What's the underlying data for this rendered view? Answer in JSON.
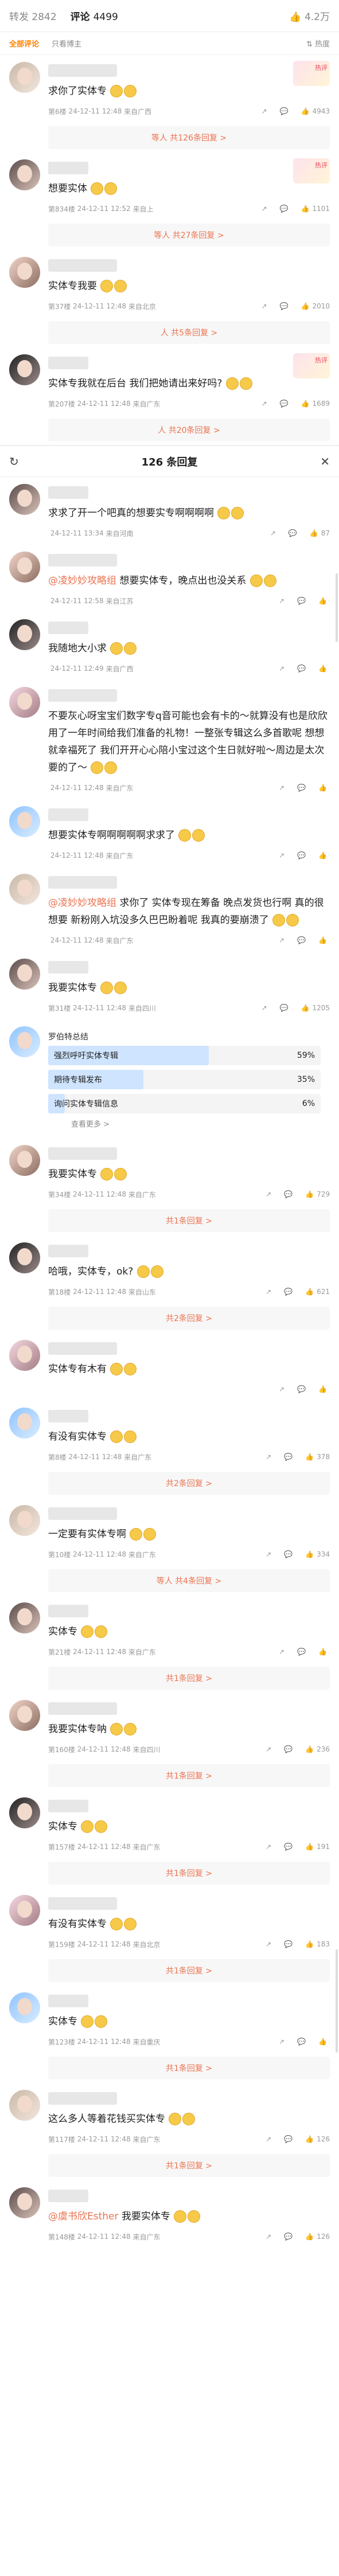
{
  "header": {
    "reposts_label": "转发",
    "reposts_count": "2842",
    "comments_label": "评论",
    "comments_count": "4499",
    "likes_icon": "thumb-up-icon",
    "likes_count": "4.2万"
  },
  "filter": {
    "all_label": "全部评论",
    "blogger_only_label": "只看博主",
    "sort_label": "热度"
  },
  "top_comments": [
    {
      "text": "求你了实体专",
      "floor": "第6楼",
      "time": "24-12-11 12:48",
      "loc": "来自广西",
      "likes": "4943",
      "replies": "等人 共126条回复 >",
      "sticker": "热评"
    },
    {
      "text": "想要实体",
      "floor": "第834楼",
      "time": "24-12-11 12:52",
      "loc": "来自上",
      "likes": "1101",
      "replies": "等人 共27条回复 >",
      "sticker": "热评"
    },
    {
      "text": "实体专我要",
      "floor": "第37楼",
      "time": "24-12-11 12:48",
      "loc": "来自北京",
      "likes": "2010",
      "replies": "人 共5条回复 >",
      "sticker": ""
    },
    {
      "text": "实体专我就在后台 我们把她请出来好吗?",
      "floor": "第207楼",
      "time": "24-12-11 12:48",
      "loc": "来自广东",
      "likes": "1689",
      "replies": "人 共20条回复 >",
      "sticker": "热评"
    }
  ],
  "panel": {
    "title": "126 条回复",
    "refresh_icon": "refresh-icon",
    "close_icon": "close-icon"
  },
  "panel_replies": [
    {
      "text": "求求了开一个吧真的想要实专啊啊啊啊",
      "floor": "",
      "time": "24-12-11 13:34",
      "loc": "来自河南",
      "likes": "87",
      "at": ""
    },
    {
      "text": "想要实体专，晚点出也没关系",
      "floor": "",
      "time": "24-12-11 12:58",
      "loc": "来自江苏",
      "likes": "",
      "at": "@凌妙妙攻略组"
    },
    {
      "text": "我随地大小求",
      "floor": "",
      "time": "24-12-11 12:49",
      "loc": "来自广西",
      "likes": "",
      "at": ""
    },
    {
      "text": "不要灰心呀宝宝们数字专q音可能也会有卡的～就算没有也是欣欣用了一年时间给我们准备的礼物！一整张专辑这么多首歌呢 想想就幸福死了 我们开开心心陪小宝过这个生日就好啦～周边是太次要的了～",
      "floor": "",
      "time": "24-12-11 12:48",
      "loc": "来自广东",
      "likes": "",
      "at": ""
    },
    {
      "text": "想要实体专啊啊啊啊啊求求了",
      "floor": "",
      "time": "24-12-11 12:48",
      "loc": "来自广东",
      "likes": "",
      "at": ""
    },
    {
      "text": "求你了 实体专现在筹备 晚点发货也行啊 真的很想要 新粉刚入坑没多久巴巴盼着呢 我真的要崩溃了",
      "floor": "",
      "time": "24-12-11 12:48",
      "loc": "来自广东",
      "likes": "",
      "at": "@凌妙妙攻略组"
    },
    {
      "text": "我要实体专",
      "floor": "第31楼",
      "time": "24-12-11 12:48",
      "loc": "来自四川",
      "likes": "1205",
      "at": ""
    }
  ],
  "poll": {
    "author": "罗伯特总结",
    "options": [
      {
        "label": "强烈呼吁实体专辑",
        "pct": "59%",
        "fraction": 0.59
      },
      {
        "label": "期待专辑发布",
        "pct": "35%",
        "fraction": 0.35
      },
      {
        "label": "询问实体专辑信息",
        "pct": "6%",
        "fraction": 0.06
      }
    ],
    "more": "查看更多 >"
  },
  "lower_comments": [
    {
      "text": "我要实体专",
      "floor": "第34楼",
      "time": "24-12-11 12:48",
      "loc": "来自广东",
      "likes": "729",
      "replies": "共1条回复 >"
    },
    {
      "text": "哈哦，实体专，ok?",
      "floor": "第18楼",
      "time": "24-12-11 12:48",
      "loc": "来自山东",
      "likes": "621",
      "replies": "共2条回复 >"
    },
    {
      "text": "实体专有木有",
      "floor": "",
      "time": "",
      "loc": "",
      "likes": "",
      "replies": ""
    },
    {
      "text": "有没有实体专",
      "floor": "第8楼",
      "time": "24-12-11 12:48",
      "loc": "来自广东",
      "likes": "378",
      "replies": "共2条回复 >"
    },
    {
      "text": "一定要有实体专啊",
      "floor": "第10楼",
      "time": "24-12-11 12:48",
      "loc": "来自广东",
      "likes": "334",
      "replies": "等人 共4条回复 >"
    },
    {
      "text": "实体专",
      "floor": "第21楼",
      "time": "24-12-11 12:48",
      "loc": "来自广东",
      "likes": "",
      "replies": "共1条回复 >"
    },
    {
      "text": "我要实体专呐",
      "floor": "第160楼",
      "time": "24-12-11 12:48",
      "loc": "来自四川",
      "likes": "236",
      "replies": "共1条回复 >"
    },
    {
      "text": "实体专",
      "floor": "第157楼",
      "time": "24-12-11 12:48",
      "loc": "来自广东",
      "likes": "191",
      "replies": "共1条回复 >"
    },
    {
      "text": "有没有实体专",
      "floor": "第159楼",
      "time": "24-12-11 12:48",
      "loc": "来自北京",
      "likes": "183",
      "replies": "共1条回复 >"
    },
    {
      "text": "实体专",
      "floor": "第123楼",
      "time": "24-12-11 12:48",
      "loc": "来自重庆",
      "likes": "",
      "replies": "共1条回复 >"
    },
    {
      "text": "这么多人等着花钱买实体专",
      "floor": "第117楼",
      "time": "24-12-11 12:48",
      "loc": "来自广东",
      "likes": "126",
      "replies": "共1条回复 >"
    },
    {
      "text": "我要实体专",
      "floor": "第148楼",
      "time": "24-12-11 12:48",
      "loc": "来自广东",
      "likes": "126",
      "replies": "",
      "at": "@虞书欣Esther"
    }
  ]
}
